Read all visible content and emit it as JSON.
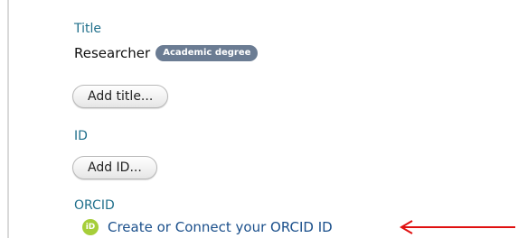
{
  "title_section": {
    "label": "Title",
    "value": "Researcher",
    "badge": "Academic degree",
    "add_button": "Add title..."
  },
  "id_section": {
    "label": "ID",
    "add_button": "Add ID..."
  },
  "orcid_section": {
    "label": "ORCID",
    "icon": "orcid-icon",
    "icon_text": "iD",
    "link": "Create or Connect your ORCID ID"
  },
  "colors": {
    "label": "#1f6f8b",
    "link": "#1a4f8b",
    "badge": "#6b7c93",
    "orcid_green": "#a6ce39",
    "arrow": "#e01010"
  }
}
